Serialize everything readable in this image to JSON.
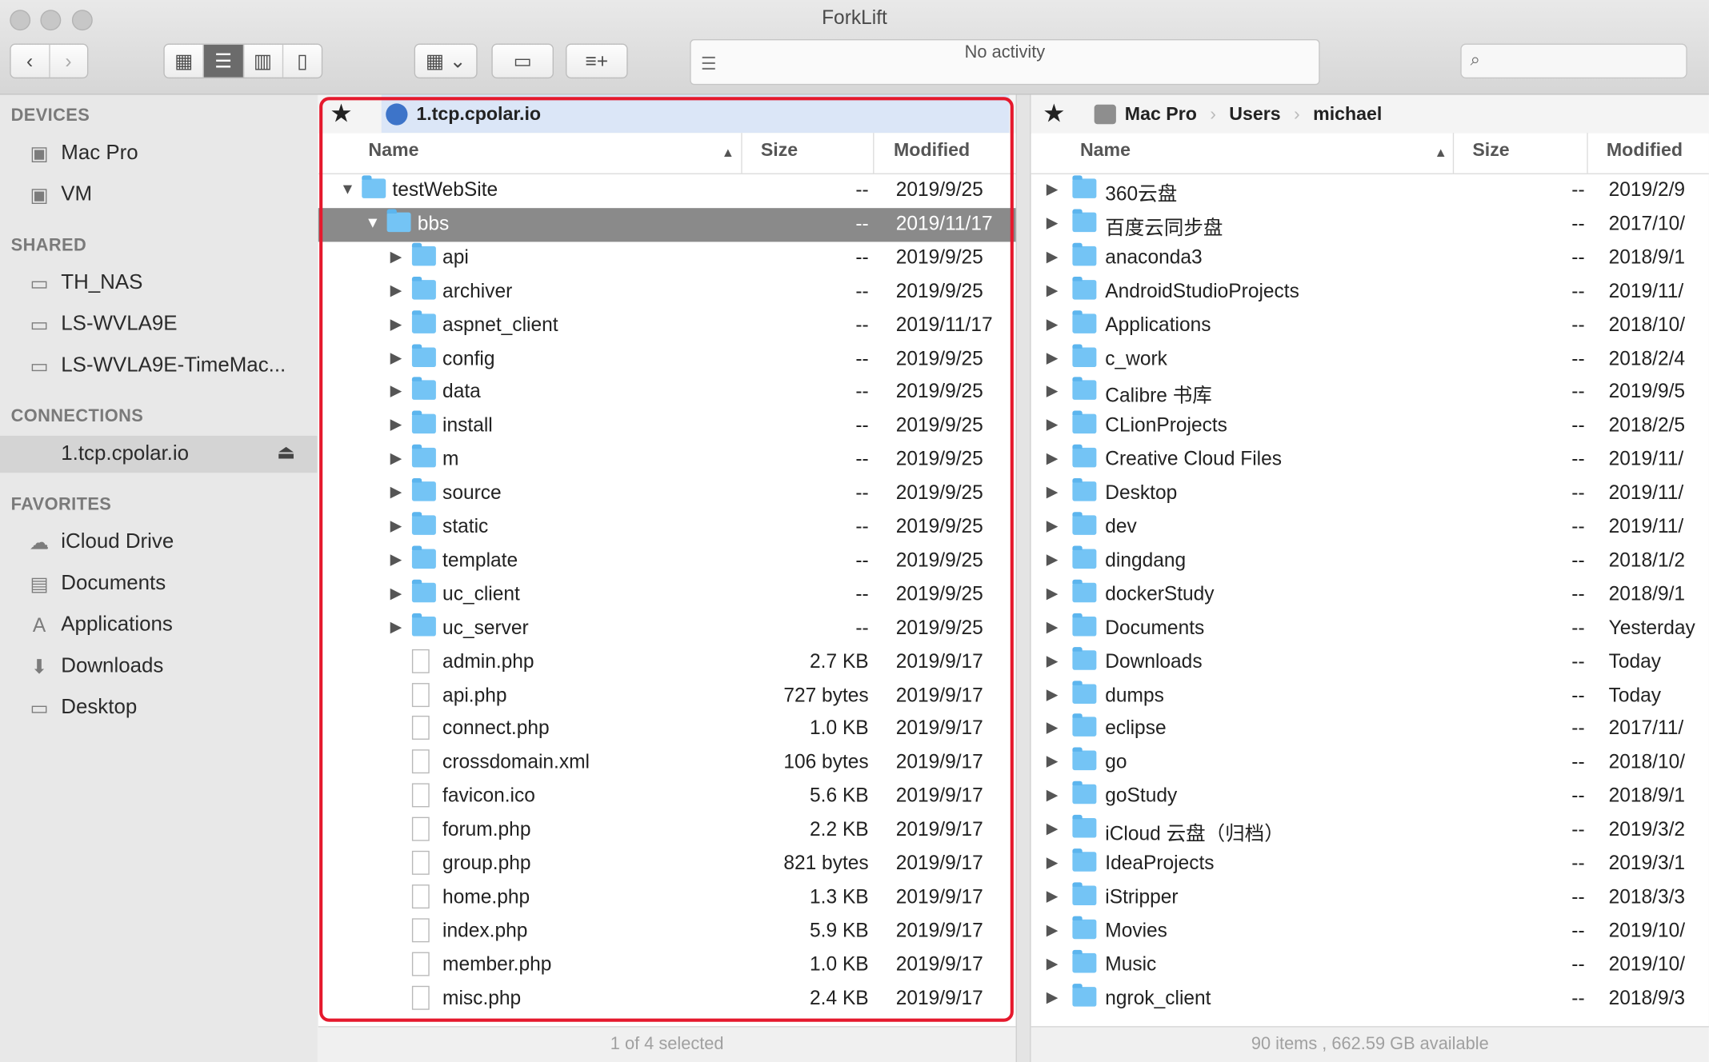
{
  "window": {
    "title": "ForkLift"
  },
  "toolbar": {
    "activity": "No activity",
    "search_glyph": "⌕"
  },
  "sidebar": {
    "devices_header": "DEVICES",
    "devices": [
      "Mac Pro",
      "VM"
    ],
    "shared_header": "SHARED",
    "shared": [
      "TH_NAS",
      "LS-WVLA9E",
      "LS-WVLA9E-TimeMac..."
    ],
    "connections_header": "CONNECTIONS",
    "connections": [
      "1.tcp.cpolar.io"
    ],
    "favorites_header": "FAVORITES",
    "favorites": [
      "iCloud Drive",
      "Documents",
      "Applications",
      "Downloads",
      "Desktop"
    ]
  },
  "left_pane": {
    "path": [
      "1.tcp.cpolar.io"
    ],
    "columns": {
      "name": "Name",
      "size": "Size",
      "modified": "Modified"
    },
    "rows": [
      {
        "name": "testWebSite",
        "size": "--",
        "modified": "2019/9/25",
        "kind": "folder",
        "level": 0,
        "expanded": true
      },
      {
        "name": "bbs",
        "size": "--",
        "modified": "2019/11/17",
        "kind": "folder",
        "level": 1,
        "expanded": true,
        "selected": true
      },
      {
        "name": "api",
        "size": "--",
        "modified": "2019/9/25",
        "kind": "folder",
        "level": 2
      },
      {
        "name": "archiver",
        "size": "--",
        "modified": "2019/9/25",
        "kind": "folder",
        "level": 2
      },
      {
        "name": "aspnet_client",
        "size": "--",
        "modified": "2019/11/17",
        "kind": "folder",
        "level": 2
      },
      {
        "name": "config",
        "size": "--",
        "modified": "2019/9/25",
        "kind": "folder",
        "level": 2
      },
      {
        "name": "data",
        "size": "--",
        "modified": "2019/9/25",
        "kind": "folder",
        "level": 2
      },
      {
        "name": "install",
        "size": "--",
        "modified": "2019/9/25",
        "kind": "folder",
        "level": 2
      },
      {
        "name": "m",
        "size": "--",
        "modified": "2019/9/25",
        "kind": "folder",
        "level": 2
      },
      {
        "name": "source",
        "size": "--",
        "modified": "2019/9/25",
        "kind": "folder",
        "level": 2
      },
      {
        "name": "static",
        "size": "--",
        "modified": "2019/9/25",
        "kind": "folder",
        "level": 2
      },
      {
        "name": "template",
        "size": "--",
        "modified": "2019/9/25",
        "kind": "folder",
        "level": 2
      },
      {
        "name": "uc_client",
        "size": "--",
        "modified": "2019/9/25",
        "kind": "folder",
        "level": 2
      },
      {
        "name": "uc_server",
        "size": "--",
        "modified": "2019/9/25",
        "kind": "folder",
        "level": 2
      },
      {
        "name": "admin.php",
        "size": "2.7 KB",
        "modified": "2019/9/17",
        "kind": "file",
        "level": 2
      },
      {
        "name": "api.php",
        "size": "727 bytes",
        "modified": "2019/9/17",
        "kind": "file",
        "level": 2
      },
      {
        "name": "connect.php",
        "size": "1.0 KB",
        "modified": "2019/9/17",
        "kind": "file",
        "level": 2
      },
      {
        "name": "crossdomain.xml",
        "size": "106 bytes",
        "modified": "2019/9/17",
        "kind": "file",
        "level": 2
      },
      {
        "name": "favicon.ico",
        "size": "5.6 KB",
        "modified": "2019/9/17",
        "kind": "file",
        "level": 2
      },
      {
        "name": "forum.php",
        "size": "2.2 KB",
        "modified": "2019/9/17",
        "kind": "file",
        "level": 2
      },
      {
        "name": "group.php",
        "size": "821 bytes",
        "modified": "2019/9/17",
        "kind": "file",
        "level": 2
      },
      {
        "name": "home.php",
        "size": "1.3 KB",
        "modified": "2019/9/17",
        "kind": "file",
        "level": 2
      },
      {
        "name": "index.php",
        "size": "5.9 KB",
        "modified": "2019/9/17",
        "kind": "file",
        "level": 2
      },
      {
        "name": "member.php",
        "size": "1.0 KB",
        "modified": "2019/9/17",
        "kind": "file",
        "level": 2
      },
      {
        "name": "misc.php",
        "size": "2.4 KB",
        "modified": "2019/9/17",
        "kind": "file",
        "level": 2
      }
    ],
    "status": "1 of 4 selected"
  },
  "right_pane": {
    "path": [
      "Mac Pro",
      "Users",
      "michael"
    ],
    "columns": {
      "name": "Name",
      "size": "Size",
      "modified": "Modified"
    },
    "rows": [
      {
        "name": "360云盘",
        "size": "--",
        "modified": "2019/2/9"
      },
      {
        "name": "百度云同步盘",
        "size": "--",
        "modified": "2017/10/"
      },
      {
        "name": "anaconda3",
        "size": "--",
        "modified": "2018/9/1"
      },
      {
        "name": "AndroidStudioProjects",
        "size": "--",
        "modified": "2019/11/"
      },
      {
        "name": "Applications",
        "size": "--",
        "modified": "2018/10/"
      },
      {
        "name": "c_work",
        "size": "--",
        "modified": "2018/2/4"
      },
      {
        "name": "Calibre 书库",
        "size": "--",
        "modified": "2019/9/5"
      },
      {
        "name": "CLionProjects",
        "size": "--",
        "modified": "2018/2/5"
      },
      {
        "name": "Creative Cloud Files",
        "size": "--",
        "modified": "2019/11/"
      },
      {
        "name": "Desktop",
        "size": "--",
        "modified": "2019/11/"
      },
      {
        "name": "dev",
        "size": "--",
        "modified": "2019/11/"
      },
      {
        "name": "dingdang",
        "size": "--",
        "modified": "2018/1/2"
      },
      {
        "name": "dockerStudy",
        "size": "--",
        "modified": "2018/9/1"
      },
      {
        "name": "Documents",
        "size": "--",
        "modified": "Yesterday"
      },
      {
        "name": "Downloads",
        "size": "--",
        "modified": "Today"
      },
      {
        "name": "dumps",
        "size": "--",
        "modified": "Today"
      },
      {
        "name": "eclipse",
        "size": "--",
        "modified": "2017/11/"
      },
      {
        "name": "go",
        "size": "--",
        "modified": "2018/10/"
      },
      {
        "name": "goStudy",
        "size": "--",
        "modified": "2018/9/1"
      },
      {
        "name": "iCloud 云盘（归档）",
        "size": "--",
        "modified": "2019/3/2"
      },
      {
        "name": "IdeaProjects",
        "size": "--",
        "modified": "2019/3/1"
      },
      {
        "name": "iStripper",
        "size": "--",
        "modified": "2018/3/3"
      },
      {
        "name": "Movies",
        "size": "--",
        "modified": "2019/10/"
      },
      {
        "name": "Music",
        "size": "--",
        "modified": "2019/10/"
      },
      {
        "name": "ngrok_client",
        "size": "--",
        "modified": "2018/9/3"
      }
    ],
    "status": "90 items , 662.59 GB available"
  },
  "colors": {
    "highlight": "#e5192d",
    "folder": "#74c4f5",
    "selection": "#8a8a8a"
  }
}
